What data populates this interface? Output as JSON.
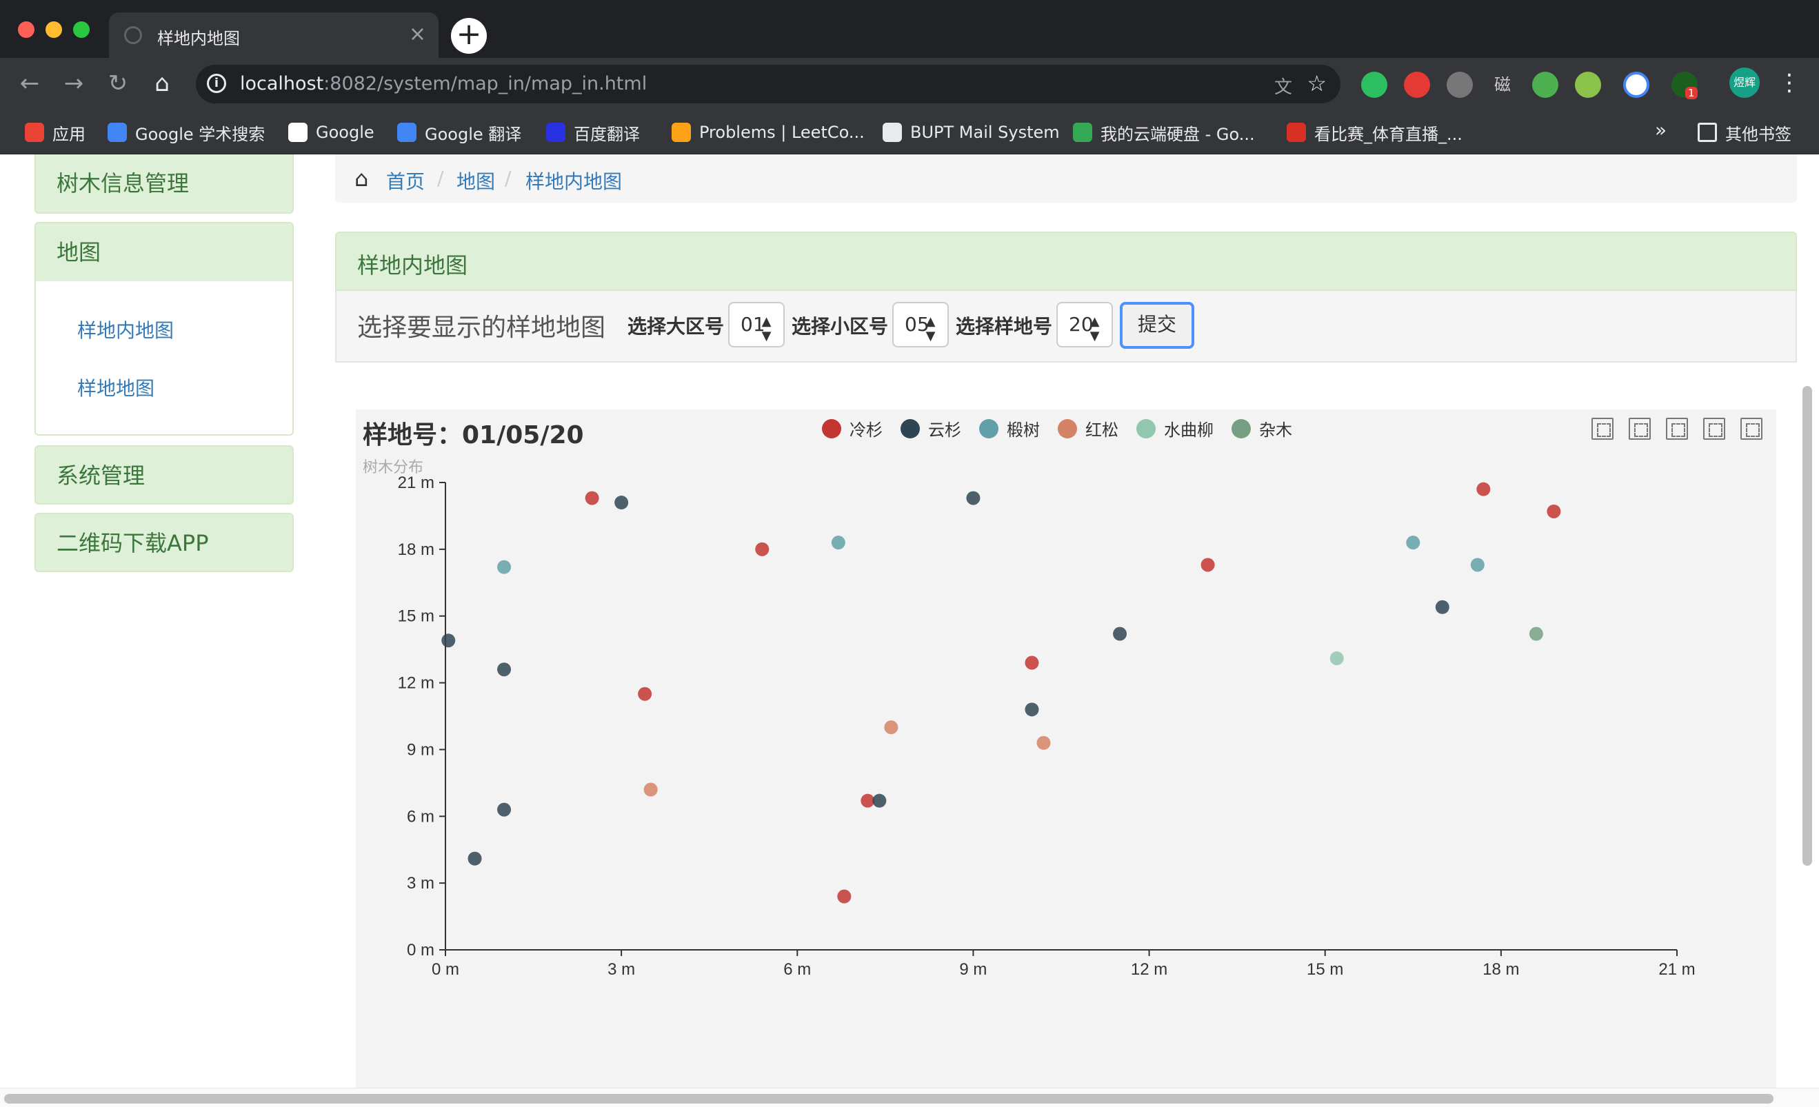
{
  "browser": {
    "tab_title": "样地内地图",
    "url_host": "localhost",
    "url_path": ":8082/system/map_in/map_in.html",
    "new_tab_glyph": "+",
    "tab_close_glyph": "×",
    "bookmarks": [
      {
        "label": "应用",
        "icon": "apps-grid-icon",
        "color": "#ea4335"
      },
      {
        "label": "Google 学术搜索",
        "icon": "scholar-icon",
        "color": "#4285f4"
      },
      {
        "label": "Google",
        "icon": "google-icon",
        "color": "#ffffff"
      },
      {
        "label": "Google 翻译",
        "icon": "translate-icon",
        "color": "#4285f4"
      },
      {
        "label": "百度翻译",
        "icon": "baidu-translate-icon",
        "color": "#2932e1"
      },
      {
        "label": "Problems | LeetCo...",
        "icon": "leetcode-icon",
        "color": "#ffa116"
      },
      {
        "label": "BUPT Mail System",
        "icon": "globe-icon",
        "color": "#e8eaed"
      },
      {
        "label": "我的云端硬盘 - Go...",
        "icon": "drive-icon",
        "color": "#34a853"
      },
      {
        "label": "看比赛_体育直播_...",
        "icon": "sports-icon",
        "color": "#d93025"
      }
    ],
    "bookmarks_more": "»",
    "other_bookmarks": "其他书签",
    "extensions_text": "磁",
    "extension_badge": "1",
    "profile_label": "煜辉"
  },
  "sidebar": {
    "items": [
      {
        "label": "树木信息管理"
      },
      {
        "label": "地图"
      },
      {
        "label": "系统管理"
      },
      {
        "label": "二维码下载APP"
      }
    ],
    "submenu": [
      {
        "label": "样地内地图"
      },
      {
        "label": "样地地图"
      }
    ]
  },
  "breadcrumb": {
    "items": [
      "首页",
      "地图",
      "样地内地图"
    ],
    "separator": "/"
  },
  "panel": {
    "title": "样地内地图",
    "form_legend": "选择要显示的样地地图",
    "big_area_label": "选择大区号",
    "big_area_value": "01",
    "small_area_label": "选择小区号",
    "small_area_value": "05",
    "plot_label": "选择样地号",
    "plot_value": "20",
    "submit_label": "提交",
    "select_arrow": "▲▼"
  },
  "chart_data": {
    "type": "scatter",
    "title": "样地号：01/05/20",
    "subtitle": "树木分布",
    "xlim": [
      0,
      21
    ],
    "ylim": [
      0,
      21
    ],
    "x_ticks": [
      0,
      3,
      6,
      9,
      12,
      15,
      18,
      21
    ],
    "y_ticks": [
      0,
      3,
      6,
      9,
      12,
      15,
      18,
      21
    ],
    "tick_suffix": " m",
    "grid": false,
    "legend_position": "top-center",
    "series": [
      {
        "name": "冷杉",
        "color": "#c23531",
        "points": [
          [
            2.5,
            20.3
          ],
          [
            5.4,
            18.0
          ],
          [
            3.4,
            11.5
          ],
          [
            7.2,
            6.7
          ],
          [
            6.8,
            2.4
          ],
          [
            10.0,
            12.9
          ],
          [
            13.0,
            17.3
          ],
          [
            17.7,
            20.7
          ],
          [
            18.9,
            19.7
          ]
        ]
      },
      {
        "name": "云杉",
        "color": "#2f4554",
        "points": [
          [
            3.0,
            20.1
          ],
          [
            9.0,
            20.3
          ],
          [
            0.05,
            13.9
          ],
          [
            1.0,
            12.6
          ],
          [
            1.0,
            6.3
          ],
          [
            0.5,
            4.1
          ],
          [
            7.4,
            6.7
          ],
          [
            10.0,
            10.8
          ],
          [
            11.5,
            14.2
          ],
          [
            17.0,
            15.4
          ]
        ]
      },
      {
        "name": "椴树",
        "color": "#61a0a8",
        "points": [
          [
            1.0,
            17.2
          ],
          [
            6.7,
            18.3
          ],
          [
            16.5,
            18.3
          ],
          [
            17.6,
            17.3
          ]
        ]
      },
      {
        "name": "红松",
        "color": "#d48265",
        "points": [
          [
            3.5,
            7.2
          ],
          [
            7.6,
            10.0
          ],
          [
            10.2,
            9.3
          ]
        ]
      },
      {
        "name": "水曲柳",
        "color": "#91c7ae",
        "points": [
          [
            15.2,
            13.1
          ]
        ]
      },
      {
        "name": "杂木",
        "color": "#749f83",
        "points": [
          [
            18.6,
            14.2
          ]
        ]
      }
    ]
  }
}
